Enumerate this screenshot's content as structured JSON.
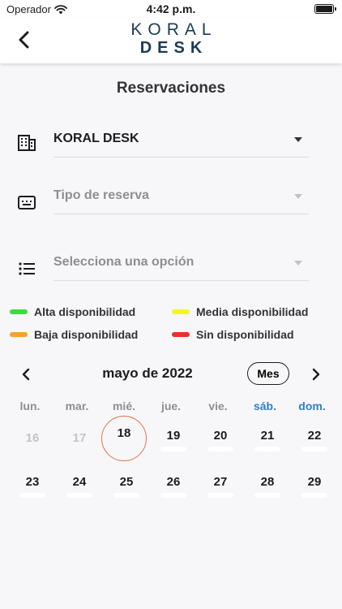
{
  "status_bar": {
    "carrier": "Operador",
    "time": "4:42 p.m."
  },
  "header": {
    "logo_top": "KORAL",
    "logo_bottom": "DESK"
  },
  "page": {
    "title": "Reservaciones"
  },
  "fields": {
    "office": {
      "value": "KORAL DESK",
      "icon": "building-icon"
    },
    "reservation_type": {
      "placeholder": "Tipo de reserva",
      "icon": "keyboard-icon"
    },
    "option": {
      "placeholder": "Selecciona una opción",
      "icon": "list-icon"
    }
  },
  "legend": [
    {
      "label": "Alta disponibilidad",
      "color": "#3ddc3d"
    },
    {
      "label": "Media disponibilidad",
      "color": "#f4f42a"
    },
    {
      "label": "Baja disponibilidad",
      "color": "#f5a12e"
    },
    {
      "label": "Sin disponibilidad",
      "color": "#ee2d2d"
    }
  ],
  "calendar": {
    "month": "mayo de 2022",
    "view_button": "Mes",
    "weekdays": [
      "lun.",
      "mar.",
      "mié.",
      "jue.",
      "vie.",
      "sáb.",
      "dom."
    ],
    "selected_day": "18",
    "week1": [
      "16",
      "17",
      "18",
      "19",
      "20",
      "21",
      "22"
    ],
    "week2": [
      "23",
      "24",
      "25",
      "26",
      "27",
      "28",
      "29"
    ],
    "disabled_days": [
      "16",
      "17"
    ],
    "weekend_color": "#2f80c8",
    "today_ring_color": "#e0734a"
  }
}
